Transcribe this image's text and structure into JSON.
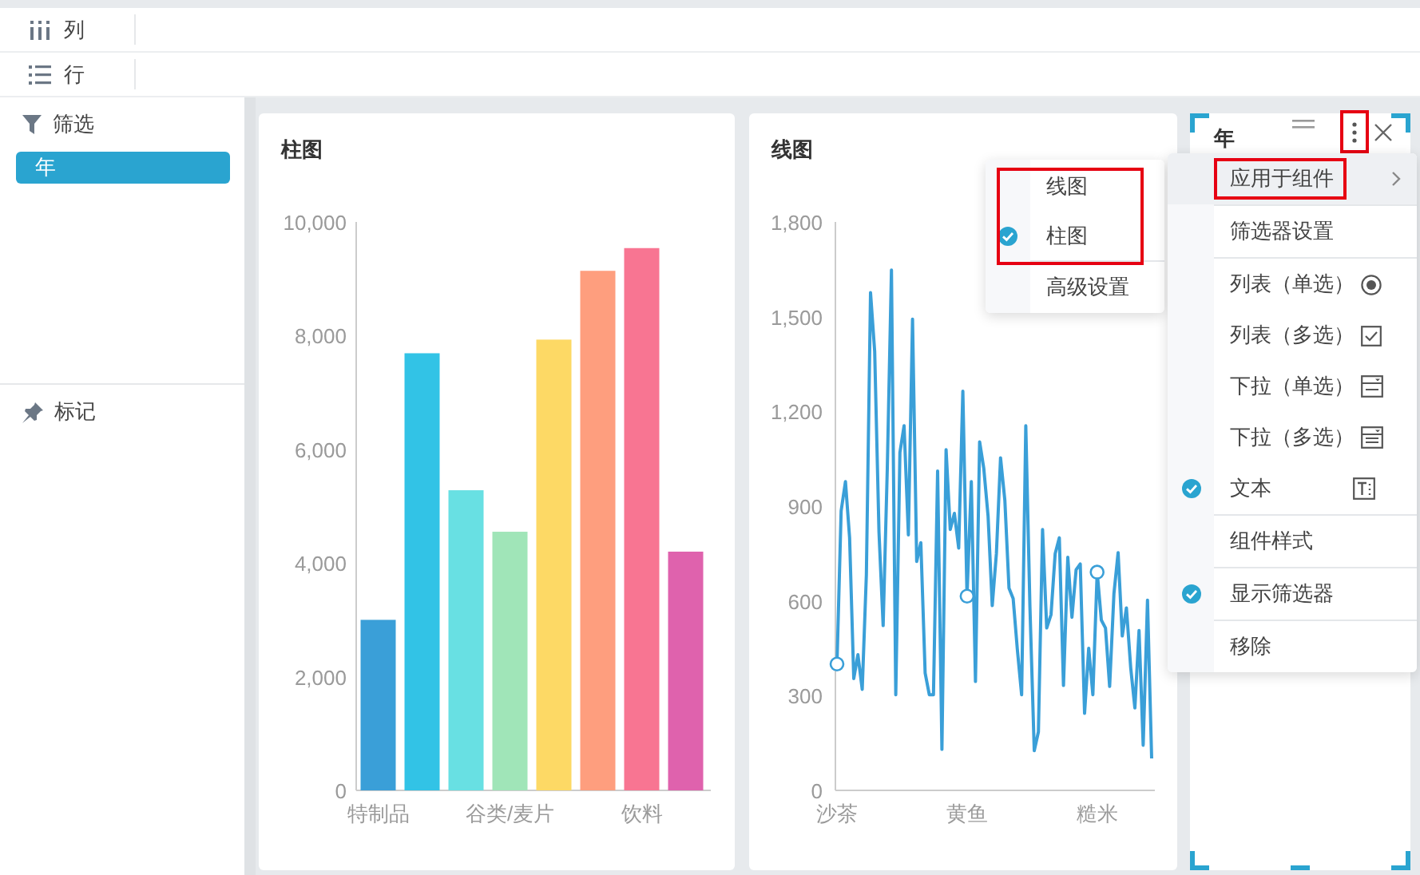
{
  "shelves": [
    {
      "kind": "columns",
      "label": "列"
    },
    {
      "kind": "rows",
      "label": "行"
    }
  ],
  "sidebar": {
    "filter": {
      "title": "筛选",
      "chips": [
        {
          "label": "年",
          "selected": true
        }
      ]
    },
    "marks": {
      "title": "标记"
    }
  },
  "cards": [
    {
      "kind": "chart",
      "chart_data": {
        "type": "bar",
        "title": "柱图",
        "values": [
          3000,
          7690,
          5280,
          4550,
          7930,
          9140,
          9540,
          4200
        ],
        "colors": [
          "#3a9fd8",
          "#32c3e6",
          "#68e0e3",
          "#a0e5b8",
          "#fdd965",
          "#fe9e7e",
          "#f87592",
          "#df62ad"
        ],
        "ylim": [
          0,
          10000
        ],
        "yticks": [
          0,
          {
            "value": 2000,
            "label": "2,000"
          },
          {
            "value": 4000,
            "label": "4,000"
          },
          {
            "value": 6000,
            "label": "6,000"
          },
          {
            "value": 8000,
            "label": "8,000"
          },
          {
            "value": 10000,
            "label": "10,000"
          }
        ],
        "categories": [
          "特制品",
          null,
          null,
          "谷类/麦片",
          null,
          null,
          "饮料",
          null
        ]
      }
    },
    {
      "kind": "chart",
      "chart_data": {
        "type": "line",
        "title": "线图",
        "series": [
          {
            "color": "#3a9fd8",
            "values": [
              400,
              885,
              978,
              800,
              354,
              430,
              320,
              683,
              1576,
              1390,
              817,
              522,
              1020,
              1648,
              303,
              1070,
              1155,
              809,
              1492,
              725,
              784,
              371,
              303,
              303,
              1011,
              130,
              1079,
              826,
              877,
              767,
              1264,
              615,
              978,
              345,
              1104,
              1020,
              868,
              585,
              750,
              1053,
              918,
              640,
              607,
              447,
              303,
              1155,
              581,
              126,
              185,
              826,
              514,
              556,
              750,
              800,
              332,
              738,
              548,
              699,
              717,
              244,
              450,
              303,
              691,
              539,
              514,
              329,
              624,
              753,
              489,
              578,
              388,
              261,
              506,
              143,
              602,
              101
            ]
          }
        ],
        "ylim": [
          0,
          1800
        ],
        "yticks": [
          0,
          300,
          600,
          900,
          {
            "value": 1200,
            "label": "1,200"
          },
          {
            "value": 1500,
            "label": "1,500"
          },
          {
            "value": 1800,
            "label": "1,800"
          }
        ],
        "categories": [
          "沙茶",
          null,
          null,
          null,
          null,
          null,
          null,
          null,
          null,
          null,
          null,
          null,
          null,
          null,
          null,
          null,
          null,
          null,
          null,
          null,
          null,
          null,
          null,
          null,
          null,
          null,
          null,
          null,
          null,
          null,
          null,
          "黄鱼",
          null,
          null,
          null,
          null,
          null,
          null,
          null,
          null,
          null,
          null,
          null,
          null,
          null,
          null,
          null,
          null,
          null,
          null,
          null,
          null,
          null,
          null,
          null,
          null,
          null,
          null,
          null,
          null,
          null,
          null,
          "糙米",
          null,
          null,
          null,
          null,
          null,
          null,
          null,
          null,
          null,
          null,
          null,
          null,
          null
        ]
      }
    },
    {
      "kind": "filter",
      "title": "年",
      "selected": true,
      "more_highlighted": true
    }
  ],
  "chart_type_menu": {
    "highlighted": true,
    "groups": [
      [
        {
          "label": "线图",
          "checked": false
        },
        {
          "label": "柱图",
          "checked": true
        }
      ],
      [
        {
          "label": "高级设置",
          "checked": false
        }
      ]
    ]
  },
  "filter_menu": {
    "groups": [
      [
        {
          "label": "应用于组件",
          "kind": "submenu",
          "checked": false,
          "highlighted": true
        }
      ],
      [
        {
          "label": "筛选器设置",
          "kind": "plain",
          "checked": false,
          "highlighted": false
        }
      ],
      [
        {
          "label": "列表（单选）",
          "kind": "radio-list",
          "checked": false,
          "highlighted": false
        },
        {
          "label": "列表（多选）",
          "kind": "check-list",
          "checked": false,
          "highlighted": false
        },
        {
          "label": "下拉（单选）",
          "kind": "dropdown-single",
          "checked": false,
          "highlighted": false
        },
        {
          "label": "下拉（多选）",
          "kind": "dropdown-multi",
          "checked": false,
          "highlighted": false
        },
        {
          "label": "文本",
          "kind": "text",
          "checked": true,
          "highlighted": false
        }
      ],
      [
        {
          "label": "组件样式",
          "kind": "plain",
          "checked": false,
          "highlighted": false
        }
      ],
      [
        {
          "label": "显示筛选器",
          "kind": "plain",
          "checked": true,
          "highlighted": false
        }
      ],
      [
        {
          "label": "移除",
          "kind": "plain",
          "checked": false,
          "highlighted": false
        }
      ]
    ]
  }
}
